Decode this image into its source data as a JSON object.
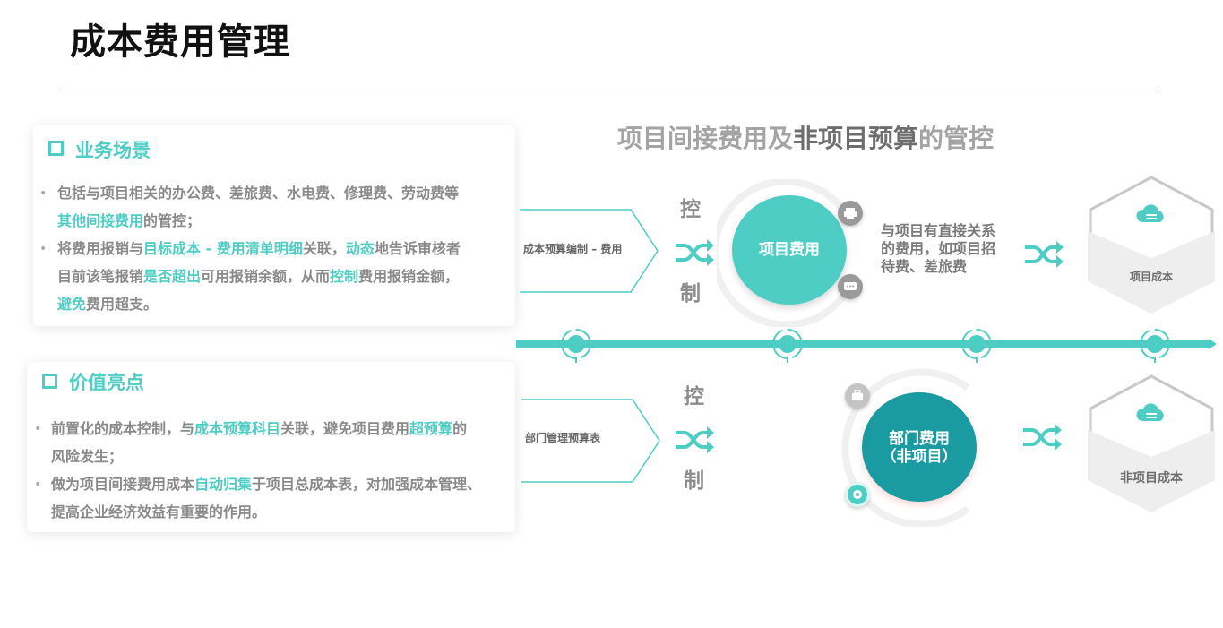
{
  "page": {
    "title": "成本费用管理"
  },
  "card1": {
    "heading": "业务场景",
    "bullet1": {
      "t1": "包括与项目相关的办公费、差旅费、水电费、修理费、劳动费等",
      "h1": "其他间接费用",
      "t2": "的管控；"
    },
    "bullet2": {
      "t1": "将费用报销与",
      "h1": "目标成本 - 费用清单明细",
      "t2": "关联，",
      "h2": "动态",
      "t3": "地告诉审核者",
      "t4": "目前该笔报销",
      "h3": "是否超出",
      "t5": "可用报销余额，从而",
      "h4": "控制",
      "t6": "费用报销金额，",
      "h5": "避免",
      "t7": "费用超支。"
    }
  },
  "card2": {
    "heading": "价值亮点",
    "bullet1": {
      "t1": "前置化的成本控制，与",
      "h1": "成本预算科目",
      "t2": "关联，避免项目费用",
      "h2": "超预算",
      "t3": "的",
      "t4": "风险发生；"
    },
    "bullet2": {
      "t1": "做为项目间接费用成本",
      "h1": "自动归集",
      "t2": "于项目总成本表，对加强成本管理、",
      "t3": "提高企业经济效益有重要的作用。"
    }
  },
  "diagram": {
    "subtitle_a": "项目间接费用及",
    "subtitle_b": "非项目预算",
    "subtitle_c": "的管控",
    "top": {
      "arrow_label": "成本预算编制 – 费用",
      "control_a": "控",
      "control_b": "制",
      "circle_label": "项目费用",
      "desc_1": "与项目有直接关系",
      "desc_2": "的费用，如项目招",
      "desc_3": "待费、差旅费",
      "hex_label": "项目成本"
    },
    "bottom": {
      "arrow_label": "部门管理预算表",
      "control_a": "控",
      "control_b": "制",
      "circle_line1": "部门费用",
      "circle_line2": "（非项目）",
      "hex_label": "非项目成本"
    }
  },
  "icons": {
    "bullet": "•",
    "card_square": "square-icon",
    "shuffle": "shuffle-icon",
    "cloud": "cloud-server-icon",
    "printer": "printer-icon",
    "chat": "chat-icon",
    "briefcase": "briefcase-icon",
    "gear": "gear-icon",
    "timeline_node": "target-icon"
  },
  "colors": {
    "accent": "#4ecdc4",
    "accent_dark": "#1a9ba1",
    "text_gray": "#8a8a8a"
  }
}
